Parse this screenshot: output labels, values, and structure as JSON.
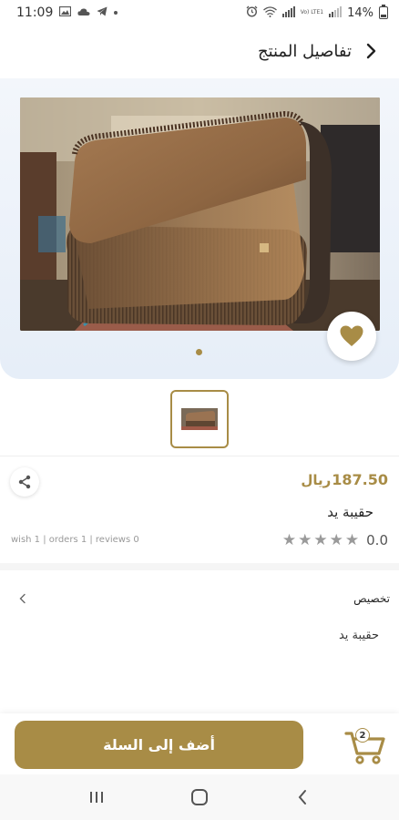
{
  "status_bar": {
    "time": "11:09",
    "battery": "14%",
    "network_label": "Vo) LTE1"
  },
  "header": {
    "title": "تفاصيل المنتج"
  },
  "product": {
    "price": "187.50",
    "currency": "ريال",
    "name": "حقيبة يد",
    "rating": "0.0",
    "stars_filled": 0,
    "stars_total": 5,
    "stats": "wish 1 | orders 1 | reviews 0"
  },
  "gallery": {
    "images_count": 1,
    "active_index": 0
  },
  "specs": {
    "label": "تخصيص",
    "value": "حقيبة يد"
  },
  "bottom_bar": {
    "add_to_cart_label": "أضف إلى السلة",
    "cart_count": "2"
  },
  "colors": {
    "accent": "#a88c46",
    "hero_bg": "#e6eef8",
    "star_empty": "#9a9a9a"
  },
  "icons": {
    "back": "chevron-right-icon",
    "favorite": "heart-icon",
    "share": "share-icon",
    "cart": "shopping-cart-icon"
  }
}
